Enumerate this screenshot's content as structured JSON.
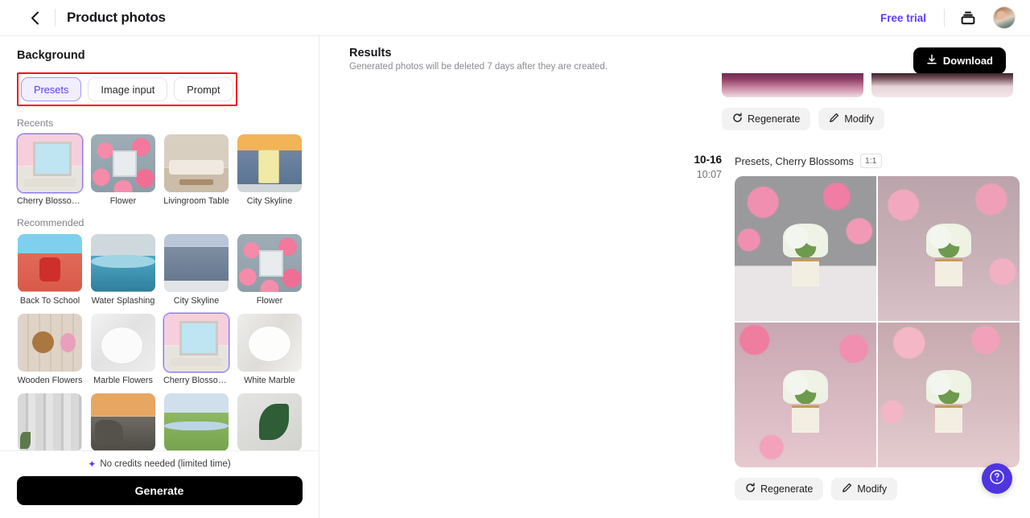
{
  "topbar": {
    "back_icon": "chevron-left-icon",
    "title": "Product photos",
    "free_trial_label": "Free trial",
    "stack_icon": "layers-icon",
    "avatar_name": "user-avatar"
  },
  "colors": {
    "accent_purple": "#5b3df5",
    "accent_soft": "#f1eeff",
    "annotation_red": "#f5110f",
    "fab_purple": "#4f35e0",
    "black_button": "#000000"
  },
  "left_panel": {
    "section_title": "Background",
    "mode_tabs": [
      {
        "label": "Presets",
        "active": true
      },
      {
        "label": "Image input",
        "active": false
      },
      {
        "label": "Prompt",
        "active": false
      }
    ],
    "groups": [
      {
        "label": "Recents",
        "items": [
          {
            "label": "Cherry Blossoms",
            "selected": true,
            "art": "art-cherrywindow"
          },
          {
            "label": "Flower",
            "selected": false,
            "art": "art-flower"
          },
          {
            "label": "Livingroom Table",
            "selected": false,
            "art": "art-living"
          },
          {
            "label": "City Skyline",
            "selected": false,
            "art": "art-city"
          }
        ]
      },
      {
        "label": "Recommended",
        "items": [
          {
            "label": "Back To School",
            "selected": false,
            "art": "art-school"
          },
          {
            "label": "Water Splashing",
            "selected": false,
            "art": "art-water"
          },
          {
            "label": "City Skyline",
            "selected": false,
            "art": "art-city2"
          },
          {
            "label": "Flower",
            "selected": false,
            "art": "art-flower"
          },
          {
            "label": "Wooden Flowers",
            "selected": false,
            "art": "art-wooden"
          },
          {
            "label": "Marble Flowers",
            "selected": false,
            "art": "art-marble"
          },
          {
            "label": "Cherry Blossoms",
            "selected": true,
            "art": "art-cherrywindow"
          },
          {
            "label": "White Marble",
            "selected": false,
            "art": "art-whitemarble"
          },
          {
            "label": "",
            "selected": false,
            "art": "art-curtain"
          },
          {
            "label": "",
            "selected": false,
            "art": "art-coast"
          },
          {
            "label": "",
            "selected": false,
            "art": "art-golf"
          },
          {
            "label": "",
            "selected": false,
            "art": "art-plant"
          }
        ]
      }
    ],
    "footer": {
      "sparkle_icon": "sparkle-icon",
      "credits_note": "No credits needed (limited time)",
      "generate_label": "Generate"
    }
  },
  "right_panel": {
    "results_title": "Results",
    "results_subtitle": "Generated photos will be deleted 7 days after they are created.",
    "download_label": "Download",
    "download_icon": "download-icon",
    "previous_actions": {
      "regenerate_label": "Regenerate",
      "modify_label": "Modify",
      "regenerate_icon": "refresh-icon",
      "modify_icon": "pencil-icon"
    },
    "result": {
      "date": "10-16",
      "time": "10:07",
      "caption": "Presets, Cherry Blossoms",
      "ratio": "1:1",
      "images": [
        "gi1",
        "gi2",
        "gi3",
        "gi4"
      ],
      "regenerate_label": "Regenerate",
      "modify_label": "Modify"
    },
    "help_icon": "question-mark-icon"
  }
}
